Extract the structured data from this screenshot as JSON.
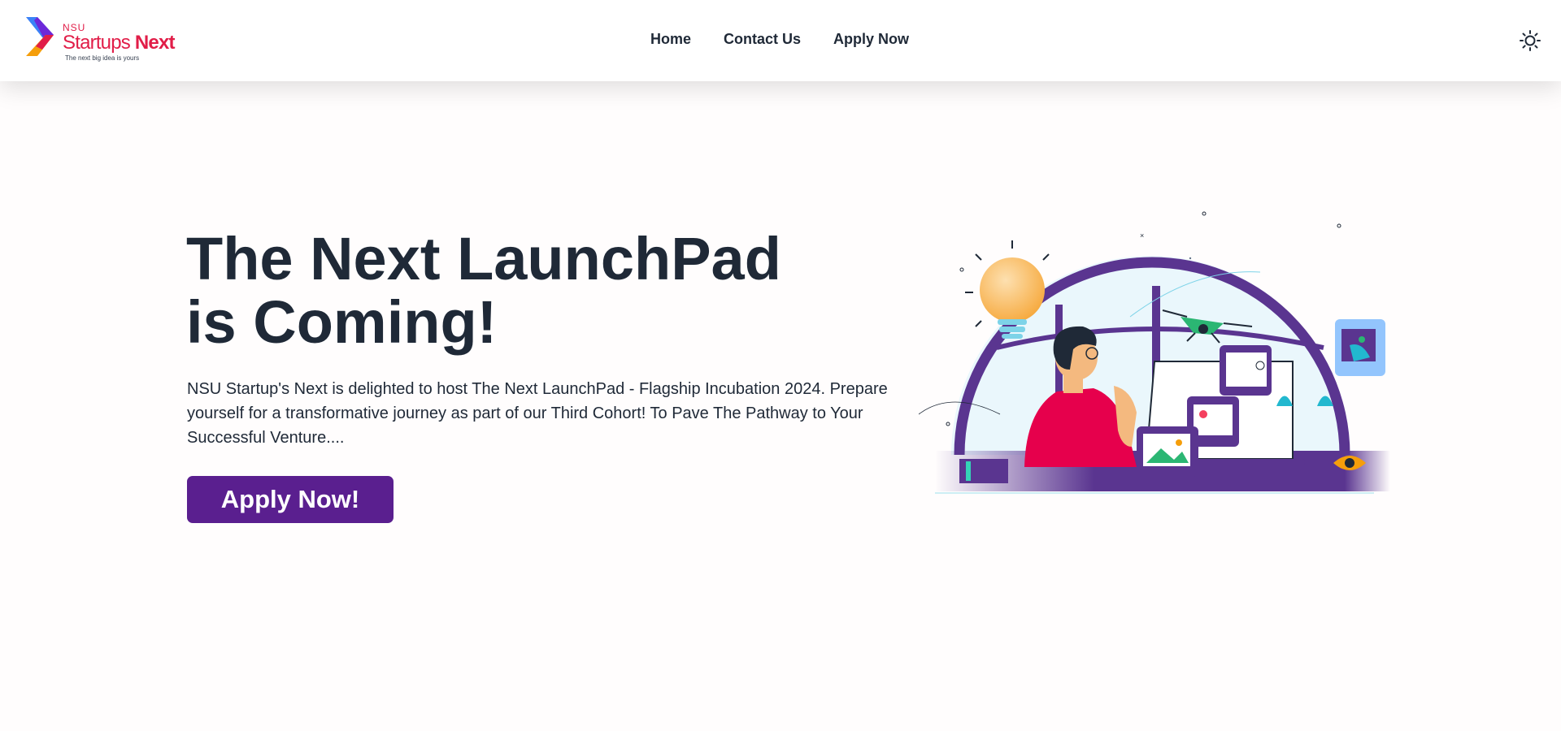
{
  "brand": {
    "nsu": "NSU",
    "name_regular": "Startups ",
    "name_bold": "Next",
    "tagline": "The next big idea is yours",
    "colors": {
      "primary": "#e11d48",
      "accent_purple": "#5a1f8f"
    }
  },
  "nav": {
    "links": [
      {
        "label": "Home"
      },
      {
        "label": "Contact Us"
      },
      {
        "label": "Apply Now"
      }
    ],
    "theme_toggle_icon": "sun-icon"
  },
  "hero": {
    "title_line1": "The Next LaunchPad",
    "title_line2": "is Coming!",
    "description": "NSU Startup's Next is delighted to host The Next LaunchPad - Flagship Incubation 2024. Prepare yourself for a transformative journey as part of our Third Cohort! To Pave The Pathway to Your Successful Venture....",
    "cta_label": "Apply Now!",
    "illustration_icon": "startup-illustration"
  }
}
